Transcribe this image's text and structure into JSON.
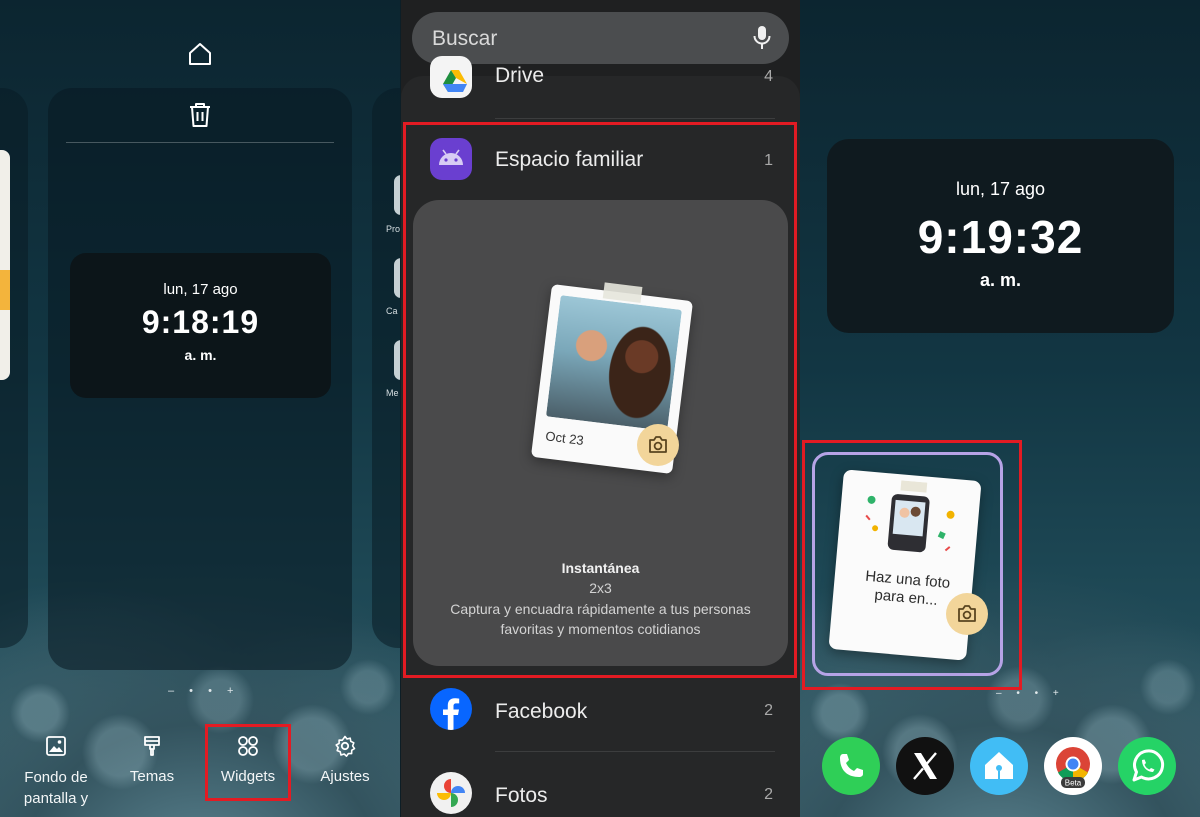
{
  "left": {
    "clock": {
      "date": "lun, 17 ago",
      "time": "9:18:19",
      "ampm": "a. m."
    },
    "peek_labels": [
      "Pro",
      "Ca",
      "Me"
    ],
    "page_indicator": "– • • +",
    "toolbar": [
      {
        "label": "Fondo de pantalla y ...",
        "icon": "image-icon"
      },
      {
        "label": "Temas",
        "icon": "paintbrush-icon"
      },
      {
        "label": "Widgets",
        "icon": "widgets-grid-icon"
      },
      {
        "label": "Ajustes",
        "icon": "gear-icon"
      }
    ]
  },
  "middle": {
    "search": {
      "placeholder": "Buscar",
      "icon": "mic-icon"
    },
    "apps": [
      {
        "name": "Drive",
        "count": "4",
        "icon": "drive-icon"
      },
      {
        "name": "Espacio familiar",
        "count": "1",
        "icon": "android-icon"
      },
      {
        "name": "Facebook",
        "count": "2",
        "icon": "facebook-icon"
      },
      {
        "name": "Fotos",
        "count": "2",
        "icon": "google-photos-icon"
      }
    ],
    "widget_preview": {
      "photo_caption": "Oct 23",
      "title": "Instantánea",
      "size": "2x3",
      "description": "Captura y encuadra rápidamente a tus personas favoritas y momentos cotidianos"
    }
  },
  "right": {
    "clock": {
      "date": "lun, 17 ago",
      "time": "9:19:32",
      "ampm": "a. m."
    },
    "placed_widget": {
      "text": "Haz una foto para en..."
    },
    "dock": [
      {
        "name": "phone-icon",
        "color": "#2fcf57"
      },
      {
        "name": "x-icon",
        "color": "#111111"
      },
      {
        "name": "home-assistant-icon",
        "color": "#41bdf5"
      },
      {
        "name": "chrome-beta-icon",
        "color": "#ffffff",
        "badge": "Beta"
      },
      {
        "name": "whatsapp-icon",
        "color": "#25d366"
      }
    ]
  },
  "colors": {
    "highlight": "#e31b23",
    "drop_frame": "#b6a3e6"
  }
}
